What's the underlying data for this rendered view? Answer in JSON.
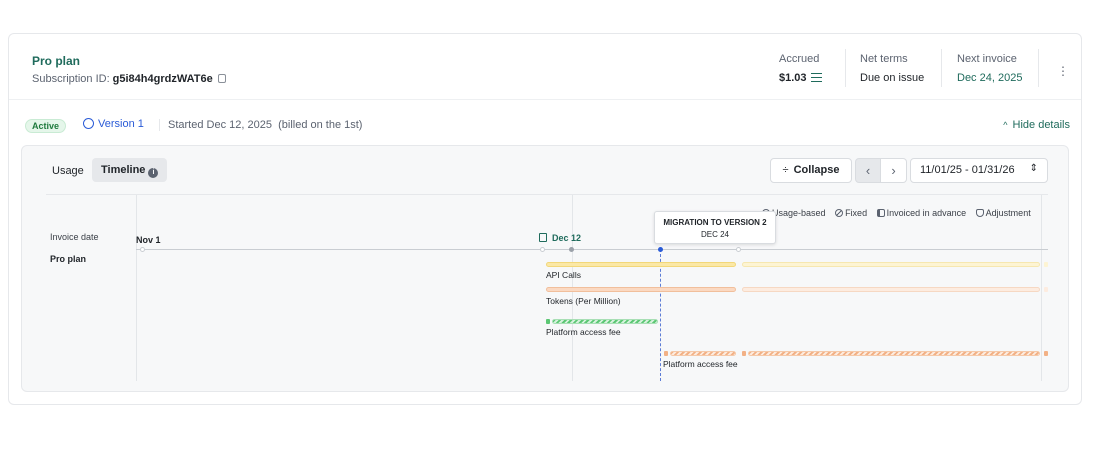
{
  "header": {
    "plan_name": "Pro plan",
    "subscription_id_label": "Subscription ID:",
    "subscription_id": "g5i84h4grdzWAT6e",
    "accrued_label": "Accrued",
    "accrued_value": "$1.03",
    "net_terms_label": "Net terms",
    "net_terms_value": "Due on issue",
    "next_invoice_label": "Next invoice",
    "next_invoice_value": "Dec 24, 2025"
  },
  "status": {
    "badge": "Active",
    "version": "Version 1",
    "started": "Started Dec 12, 2025",
    "billed": "(billed on the 1st)",
    "hide_details": "Hide details"
  },
  "timeline": {
    "tabs": [
      "Usage",
      "Timeline"
    ],
    "collapse_label": "Collapse",
    "date_range": "11/01/25 - 01/31/26",
    "legend": [
      "Usage-based",
      "Fixed",
      "Invoiced in advance",
      "Adjustment"
    ],
    "invoice_date_label": "Invoice date",
    "plan_row_label": "Pro plan",
    "date_nov1": "Nov 1",
    "date_dec12": "Dec 12",
    "tooltip_title": "MIGRATION TO VERSION 2",
    "tooltip_date": "DEC 24",
    "items": [
      {
        "label": "API Calls",
        "type": "Usage-based"
      },
      {
        "label": "Tokens (Per Million)",
        "type": "Usage-based"
      },
      {
        "label": "Platform access fee",
        "type": "Invoiced in advance"
      },
      {
        "label": "Platform access fee",
        "type": "Invoiced in advance"
      }
    ]
  },
  "colors": {
    "brand": "#1f6b5c",
    "link": "#2a5bd7",
    "active_badge_bg": "#e5f6ea",
    "api_calls": "#fbe8a6",
    "tokens": "#fbd9c2",
    "fee_v1": "#5cc774",
    "fee_v2": "#f2b186"
  },
  "icons": [
    "copy-icon",
    "list-icon",
    "kebab-icon",
    "clock-icon",
    "info-icon",
    "collapse-icon",
    "chevron-left-icon",
    "chevron-right-icon",
    "sort-icon",
    "calendar-icon"
  ]
}
